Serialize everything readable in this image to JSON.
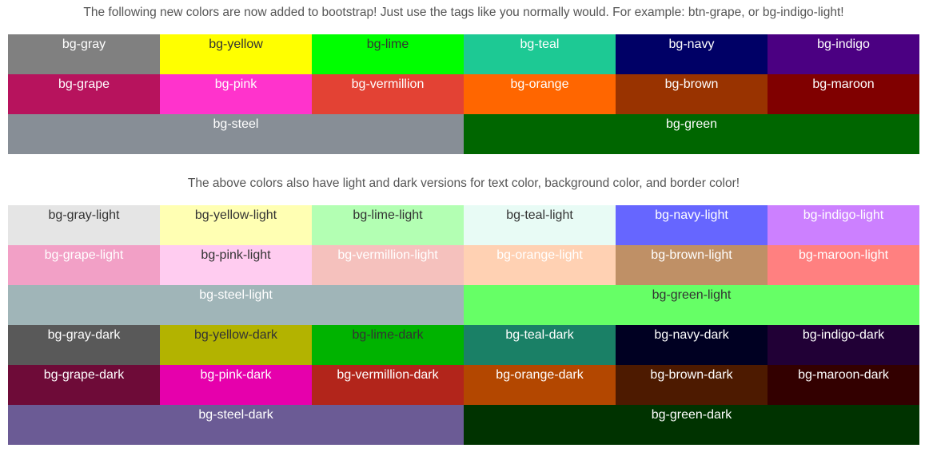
{
  "intro_top": "The following new colors are now added to bootstrap! Just use the tags like you normally would. For example: btn-grape, or bg-indigo-light!",
  "intro_bottom": "The above colors also have light and dark versions for text color, background color, and border color!",
  "base_swatches": [
    {
      "label": "bg-gray",
      "bg": "#808080",
      "fg": "#ffffff",
      "wide": false
    },
    {
      "label": "bg-yellow",
      "bg": "#ffff00",
      "fg": "#333333",
      "wide": false
    },
    {
      "label": "bg-lime",
      "bg": "#00ff00",
      "fg": "#333333",
      "wide": false
    },
    {
      "label": "bg-teal",
      "bg": "#1dc994",
      "fg": "#ffffff",
      "wide": false
    },
    {
      "label": "bg-navy",
      "bg": "#000066",
      "fg": "#ffffff",
      "wide": false
    },
    {
      "label": "bg-indigo",
      "bg": "#4b0082",
      "fg": "#ffffff",
      "wide": false
    },
    {
      "label": "bg-grape",
      "bg": "#b7135d",
      "fg": "#ffffff",
      "wide": false
    },
    {
      "label": "bg-pink",
      "bg": "#ff33cc",
      "fg": "#ffffff",
      "wide": false
    },
    {
      "label": "bg-vermillion",
      "bg": "#e34234",
      "fg": "#ffffff",
      "wide": false
    },
    {
      "label": "bg-orange",
      "bg": "#ff6600",
      "fg": "#ffffff",
      "wide": false
    },
    {
      "label": "bg-brown",
      "bg": "#993300",
      "fg": "#ffffff",
      "wide": false
    },
    {
      "label": "bg-maroon",
      "bg": "#800000",
      "fg": "#ffffff",
      "wide": false
    },
    {
      "label": "bg-steel",
      "bg": "#878e96",
      "fg": "#ffffff",
      "wide": true
    },
    {
      "label": "bg-green",
      "bg": "#006600",
      "fg": "#ffffff",
      "wide": true
    }
  ],
  "variant_swatches": [
    {
      "label": "bg-gray-light",
      "bg": "#e5e5e5",
      "fg": "#333333",
      "wide": false
    },
    {
      "label": "bg-yellow-light",
      "bg": "#ffffb3",
      "fg": "#333333",
      "wide": false
    },
    {
      "label": "bg-lime-light",
      "bg": "#b3ffb3",
      "fg": "#333333",
      "wide": false
    },
    {
      "label": "bg-teal-light",
      "bg": "#e8fbf5",
      "fg": "#333333",
      "wide": false
    },
    {
      "label": "bg-navy-light",
      "bg": "#6666ff",
      "fg": "#ffffff",
      "wide": false
    },
    {
      "label": "bg-indigo-light",
      "bg": "#cc80ff",
      "fg": "#ffffff",
      "wide": false
    },
    {
      "label": "bg-grape-light",
      "bg": "#f2a0c6",
      "fg": "#ffffff",
      "wide": false
    },
    {
      "label": "bg-pink-light",
      "bg": "#ffccf0",
      "fg": "#333333",
      "wide": false
    },
    {
      "label": "bg-vermillion-light",
      "bg": "#f5c1bd",
      "fg": "#ffffff",
      "wide": false
    },
    {
      "label": "bg-orange-light",
      "bg": "#ffd1b3",
      "fg": "#ffffff",
      "wide": false
    },
    {
      "label": "bg-brown-light",
      "bg": "#bf9066",
      "fg": "#ffffff",
      "wide": false
    },
    {
      "label": "bg-maroon-light",
      "bg": "#ff8080",
      "fg": "#ffffff",
      "wide": false
    },
    {
      "label": "bg-steel-light",
      "bg": "#a0b5b8",
      "fg": "#ffffff",
      "wide": true
    },
    {
      "label": "bg-green-light",
      "bg": "#66ff66",
      "fg": "#333333",
      "wide": true
    },
    {
      "label": "bg-gray-dark",
      "bg": "#595959",
      "fg": "#ffffff",
      "wide": false
    },
    {
      "label": "bg-yellow-dark",
      "bg": "#b3b300",
      "fg": "#333333",
      "wide": false
    },
    {
      "label": "bg-lime-dark",
      "bg": "#00b300",
      "fg": "#333333",
      "wide": false
    },
    {
      "label": "bg-teal-dark",
      "bg": "#1a8066",
      "fg": "#ffffff",
      "wide": false
    },
    {
      "label": "bg-navy-dark",
      "bg": "#000022",
      "fg": "#ffffff",
      "wide": false
    },
    {
      "label": "bg-indigo-dark",
      "bg": "#210036",
      "fg": "#ffffff",
      "wide": false
    },
    {
      "label": "bg-grape-dark",
      "bg": "#6e0b38",
      "fg": "#ffffff",
      "wide": false
    },
    {
      "label": "bg-pink-dark",
      "bg": "#e600ac",
      "fg": "#ffffff",
      "wide": false
    },
    {
      "label": "bg-vermillion-dark",
      "bg": "#b2251b",
      "fg": "#ffffff",
      "wide": false
    },
    {
      "label": "bg-orange-dark",
      "bg": "#b34700",
      "fg": "#ffffff",
      "wide": false
    },
    {
      "label": "bg-brown-dark",
      "bg": "#4d1a00",
      "fg": "#ffffff",
      "wide": false
    },
    {
      "label": "bg-maroon-dark",
      "bg": "#330000",
      "fg": "#ffffff",
      "wide": false
    },
    {
      "label": "bg-steel-dark",
      "bg": "#6b5b95",
      "fg": "#ffffff",
      "wide": true
    },
    {
      "label": "bg-green-dark",
      "bg": "#003300",
      "fg": "#ffffff",
      "wide": true
    }
  ]
}
